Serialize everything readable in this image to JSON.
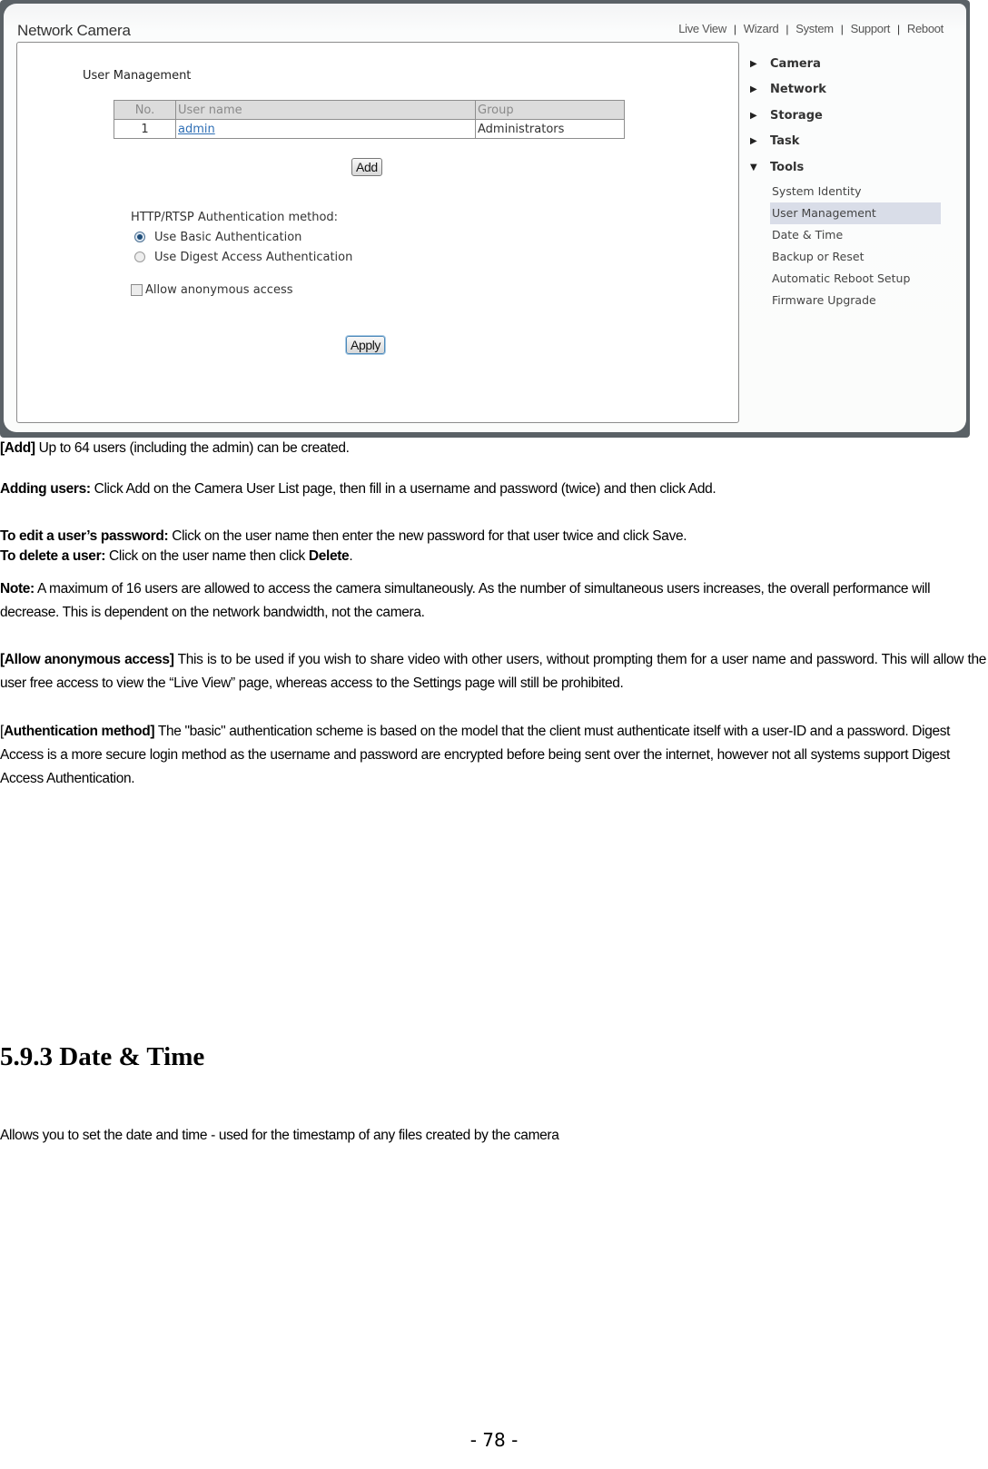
{
  "screenshot": {
    "app_title": "Network Camera",
    "top_nav": [
      {
        "label": "Live View"
      },
      {
        "label": "Wizard"
      },
      {
        "label": "System"
      },
      {
        "label": "Support"
      },
      {
        "label": "Reboot"
      }
    ],
    "section_title": "User Management",
    "user_table": {
      "columns": [
        "No.",
        "User name",
        "Group"
      ],
      "rows": [
        {
          "no": "1",
          "user_name": "admin",
          "group": "Administrators"
        }
      ]
    },
    "add_button": "Add",
    "auth": {
      "label": "HTTP/RTSP Authentication method:",
      "options": [
        {
          "label": "Use Basic Authentication",
          "checked": true
        },
        {
          "label": "Use Digest Access Authentication",
          "checked": false
        }
      ],
      "anonymous_label": "Allow anonymous access",
      "anonymous_checked": false
    },
    "apply_button": "Apply",
    "sidebar": {
      "menu": [
        {
          "label": "Camera",
          "expanded": false
        },
        {
          "label": "Network",
          "expanded": false
        },
        {
          "label": "Storage",
          "expanded": false
        },
        {
          "label": "Task",
          "expanded": false
        },
        {
          "label": "Tools",
          "expanded": true
        }
      ],
      "tools_submenu": [
        {
          "label": "System Identity",
          "active": false
        },
        {
          "label": "User Management",
          "active": true
        },
        {
          "label": "Date & Time",
          "active": false
        },
        {
          "label": "Backup or Reset",
          "active": false
        },
        {
          "label": "Automatic Reboot Setup",
          "active": false
        },
        {
          "label": "Firmware Upgrade",
          "active": false
        }
      ]
    }
  },
  "document": {
    "add": {
      "bold": "[Add]",
      "text": " Up to 64 users (including the admin) can be created."
    },
    "adding_users": {
      "bold": "Adding users:",
      "text": " Click Add on the Camera User List page, then fill in a username and password (twice) and then click Add."
    },
    "edit_password": {
      "bold": "To edit a user’s password:",
      "text": " Click on the user name then enter the new password for that user twice and click Save."
    },
    "delete_user": {
      "bold": "To delete a user:",
      "text": " Click on the user name then click ",
      "bold2": "Delete",
      "text2": "."
    },
    "note": {
      "bold": "Note:",
      "text": " A maximum of 16 users are allowed to access the camera simultaneously. As the number of simultaneous users increases, the overall performance will decrease. This is dependent on the network bandwidth, not the camera."
    },
    "anonymous": {
      "bold": "[Allow anonymous access]",
      "text": " This is to be used if you wish to share video with other users, without prompting them for a user name and password. This will allow the user free access to view the “Live View” page, whereas access to the Settings page will still be prohibited."
    },
    "auth_method": {
      "pre": "[",
      "bold": "Authentication method]",
      "text": " The \"basic\" authentication scheme is based on the model that the client must authenticate itself with a user-ID and a password. Digest Access is a more secure login method as the username and password are encrypted before being sent over the internet, however not all systems support Digest Access Authentication."
    },
    "heading": "5.9.3 Date & Time",
    "date_time_desc": "Allows you to set the date and time - used for the timestamp of any files created by the camera",
    "page_number": "- 78 -"
  }
}
